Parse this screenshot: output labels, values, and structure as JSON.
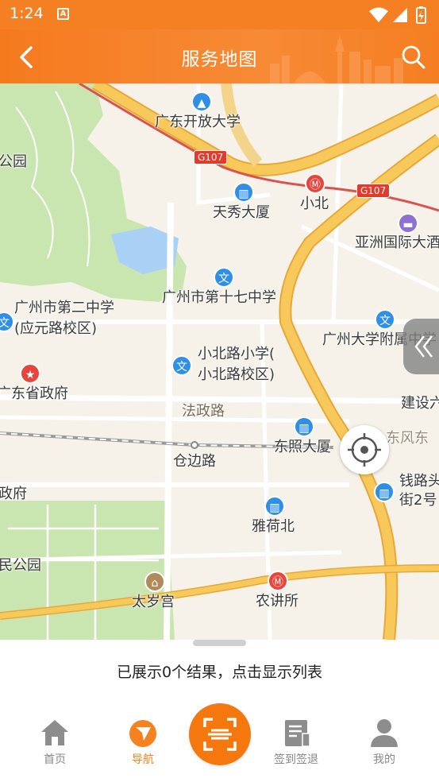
{
  "status_bar": {
    "time": "1:24",
    "notification_icon": "A"
  },
  "app_bar": {
    "title": "服务地图",
    "back_icon": "chevron-left-icon",
    "search_icon": "search-icon"
  },
  "map": {
    "labels": {
      "open_university": "广东开放大学",
      "tianxiu": "天秀大厦",
      "xiaobei": "小北",
      "asia_hotel": "亚洲国际大酒",
      "no17_school": "广州市第十七中学",
      "no2_school_1": "广州市第二中学",
      "no2_school_2": "(应元路校区)",
      "university_affiliated": "广州大学附属中学",
      "xiaobeilu_school_1": "小北路小学(",
      "xiaobeilu_school_2": "小北路校区)",
      "gov": "广东省政府",
      "park_left": "公园",
      "fa_zheng_road": "法政路",
      "jianshe": "建设六",
      "dongzhao": "东照大厦",
      "dongfeng": "东风东",
      "cangbian_road": "仓边路",
      "qianlu_1": "钱路头",
      "qianlu_2": "街2号",
      "fu": "政府",
      "yahe_north": "雅荷北",
      "people_park": "民公园",
      "taisui": "太岁宫",
      "nongjiangsuo": "农讲所"
    },
    "shields": {
      "g107_a": "G107",
      "g107_b": "G107"
    },
    "colors": {
      "land": "#f6f2ea",
      "park": "#c9e5b0",
      "main_road": "#f3b948",
      "metro": "#d9534f",
      "water": "#a9d0f5"
    }
  },
  "sheet": {
    "summary": "已展示0个结果，点击显示列表"
  },
  "bottom_nav": {
    "items": [
      {
        "label": "首页",
        "icon": "home-icon"
      },
      {
        "label": "导航",
        "icon": "navigation-icon"
      },
      {
        "label": "",
        "icon": "scan-icon"
      },
      {
        "label": "签到签退",
        "icon": "checkin-icon"
      },
      {
        "label": "我的",
        "icon": "profile-icon"
      }
    ],
    "active": "导航",
    "accent": "#f5821f"
  }
}
